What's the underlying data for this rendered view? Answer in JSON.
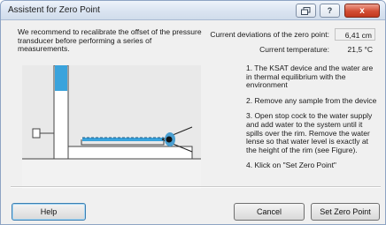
{
  "window": {
    "title": "Assistent for Zero Point",
    "close_glyph": "x",
    "help_glyph": "?",
    "restore_icon": "restore-icon"
  },
  "intro": {
    "text": "We recommend to recalibrate the offset of the pressure transducer before performing a series of measurements."
  },
  "stats": {
    "deviation_label": "Current deviations of the zero point:",
    "deviation_value": "6,41 cm",
    "temperature_label": "Current temperature:",
    "temperature_value": "21,5 °C"
  },
  "steps": [
    "1. The KSAT device and the water are in thermal equilibrium with the environment",
    "2. Remove any sample from the device",
    "3. Open stop cock to the water supply and add water to the system until it spills over the rim. Remove the water lense so that water level is exactly at the height of the rim (see Figure).",
    "4. Klick on \"Set Zero Point\""
  ],
  "buttons": {
    "help": "Help",
    "cancel": "Cancel",
    "set_zero": "Set Zero Point"
  },
  "figure": {
    "icon": "eye-icon",
    "water_color": "#3aa3dc",
    "frame_color": "#ffffff",
    "base_color": "#f2f2f2"
  }
}
